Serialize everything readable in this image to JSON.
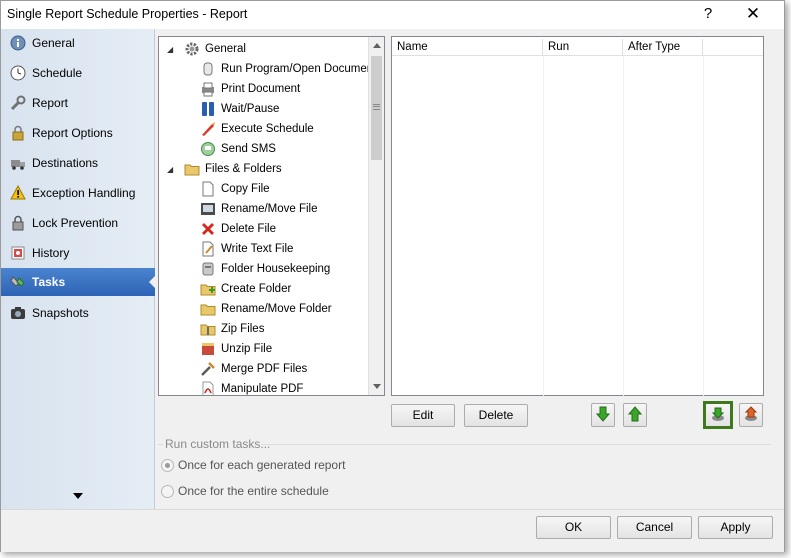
{
  "window": {
    "title": "Single Report Schedule Properties - Report",
    "help_glyph": "?",
    "close_glyph": "✕"
  },
  "sidebar": {
    "items": [
      {
        "label": "General",
        "icon": "info-icon"
      },
      {
        "label": "Schedule",
        "icon": "clock-icon"
      },
      {
        "label": "Report",
        "icon": "wrench-icon"
      },
      {
        "label": "Report Options",
        "icon": "lock-icon"
      },
      {
        "label": "Destinations",
        "icon": "truck-icon"
      },
      {
        "label": "Exception Handling",
        "icon": "warning-icon"
      },
      {
        "label": "Lock Prevention",
        "icon": "lock-icon"
      },
      {
        "label": "History",
        "icon": "history-icon"
      },
      {
        "label": "Tasks",
        "icon": "tasks-icon",
        "active": true
      },
      {
        "label": "Snapshots",
        "icon": "camera-icon"
      }
    ]
  },
  "tree": {
    "items": [
      {
        "label": "General",
        "level": 0,
        "expanded": true,
        "icon": "gear-icon"
      },
      {
        "label": "Run Program/Open Document",
        "level": 1,
        "icon": "run-program-icon"
      },
      {
        "label": "Print Document",
        "level": 1,
        "icon": "printer-icon"
      },
      {
        "label": "Wait/Pause",
        "level": 1,
        "icon": "pause-icon"
      },
      {
        "label": "Execute Schedule",
        "level": 1,
        "icon": "execute-icon"
      },
      {
        "label": "Send SMS",
        "level": 1,
        "icon": "sms-icon"
      },
      {
        "label": "Files & Folders",
        "level": 0,
        "expanded": true,
        "icon": "folder-icon"
      },
      {
        "label": "Copy File",
        "level": 1,
        "icon": "copy-file-icon"
      },
      {
        "label": "Rename/Move File",
        "level": 1,
        "icon": "rename-file-icon"
      },
      {
        "label": "Delete File",
        "level": 1,
        "icon": "delete-icon"
      },
      {
        "label": "Write Text File",
        "level": 1,
        "icon": "write-file-icon"
      },
      {
        "label": "Folder Housekeeping",
        "level": 1,
        "icon": "housekeeping-icon"
      },
      {
        "label": "Create Folder",
        "level": 1,
        "icon": "create-folder-icon"
      },
      {
        "label": "Rename/Move Folder",
        "level": 1,
        "icon": "rename-folder-icon"
      },
      {
        "label": "Zip Files",
        "level": 1,
        "icon": "zip-icon"
      },
      {
        "label": "Unzip File",
        "level": 1,
        "icon": "unzip-icon"
      },
      {
        "label": "Merge PDF Files",
        "level": 1,
        "icon": "merge-pdf-icon"
      },
      {
        "label": "Manipulate PDF",
        "level": 1,
        "icon": "pdf-icon"
      }
    ]
  },
  "task_grid": {
    "columns": [
      "Name",
      "Run",
      "After Type"
    ],
    "rows": []
  },
  "actions": {
    "edit": "Edit",
    "delete": "Delete",
    "move_down": "arrow-down-icon",
    "move_up": "arrow-up-icon",
    "import": "import-task-icon",
    "export": "export-task-icon"
  },
  "run_custom": {
    "label": "Run custom tasks...",
    "options": [
      {
        "label": "Once for each generated report",
        "checked": true
      },
      {
        "label": "Once for the entire schedule",
        "checked": false
      }
    ]
  },
  "footer": {
    "ok": "OK",
    "cancel": "Cancel",
    "apply": "Apply"
  },
  "colors": {
    "active_nav": "#2d63b5",
    "highlight_border": "#3d7a1e",
    "arrow_green": "#3aa629"
  }
}
